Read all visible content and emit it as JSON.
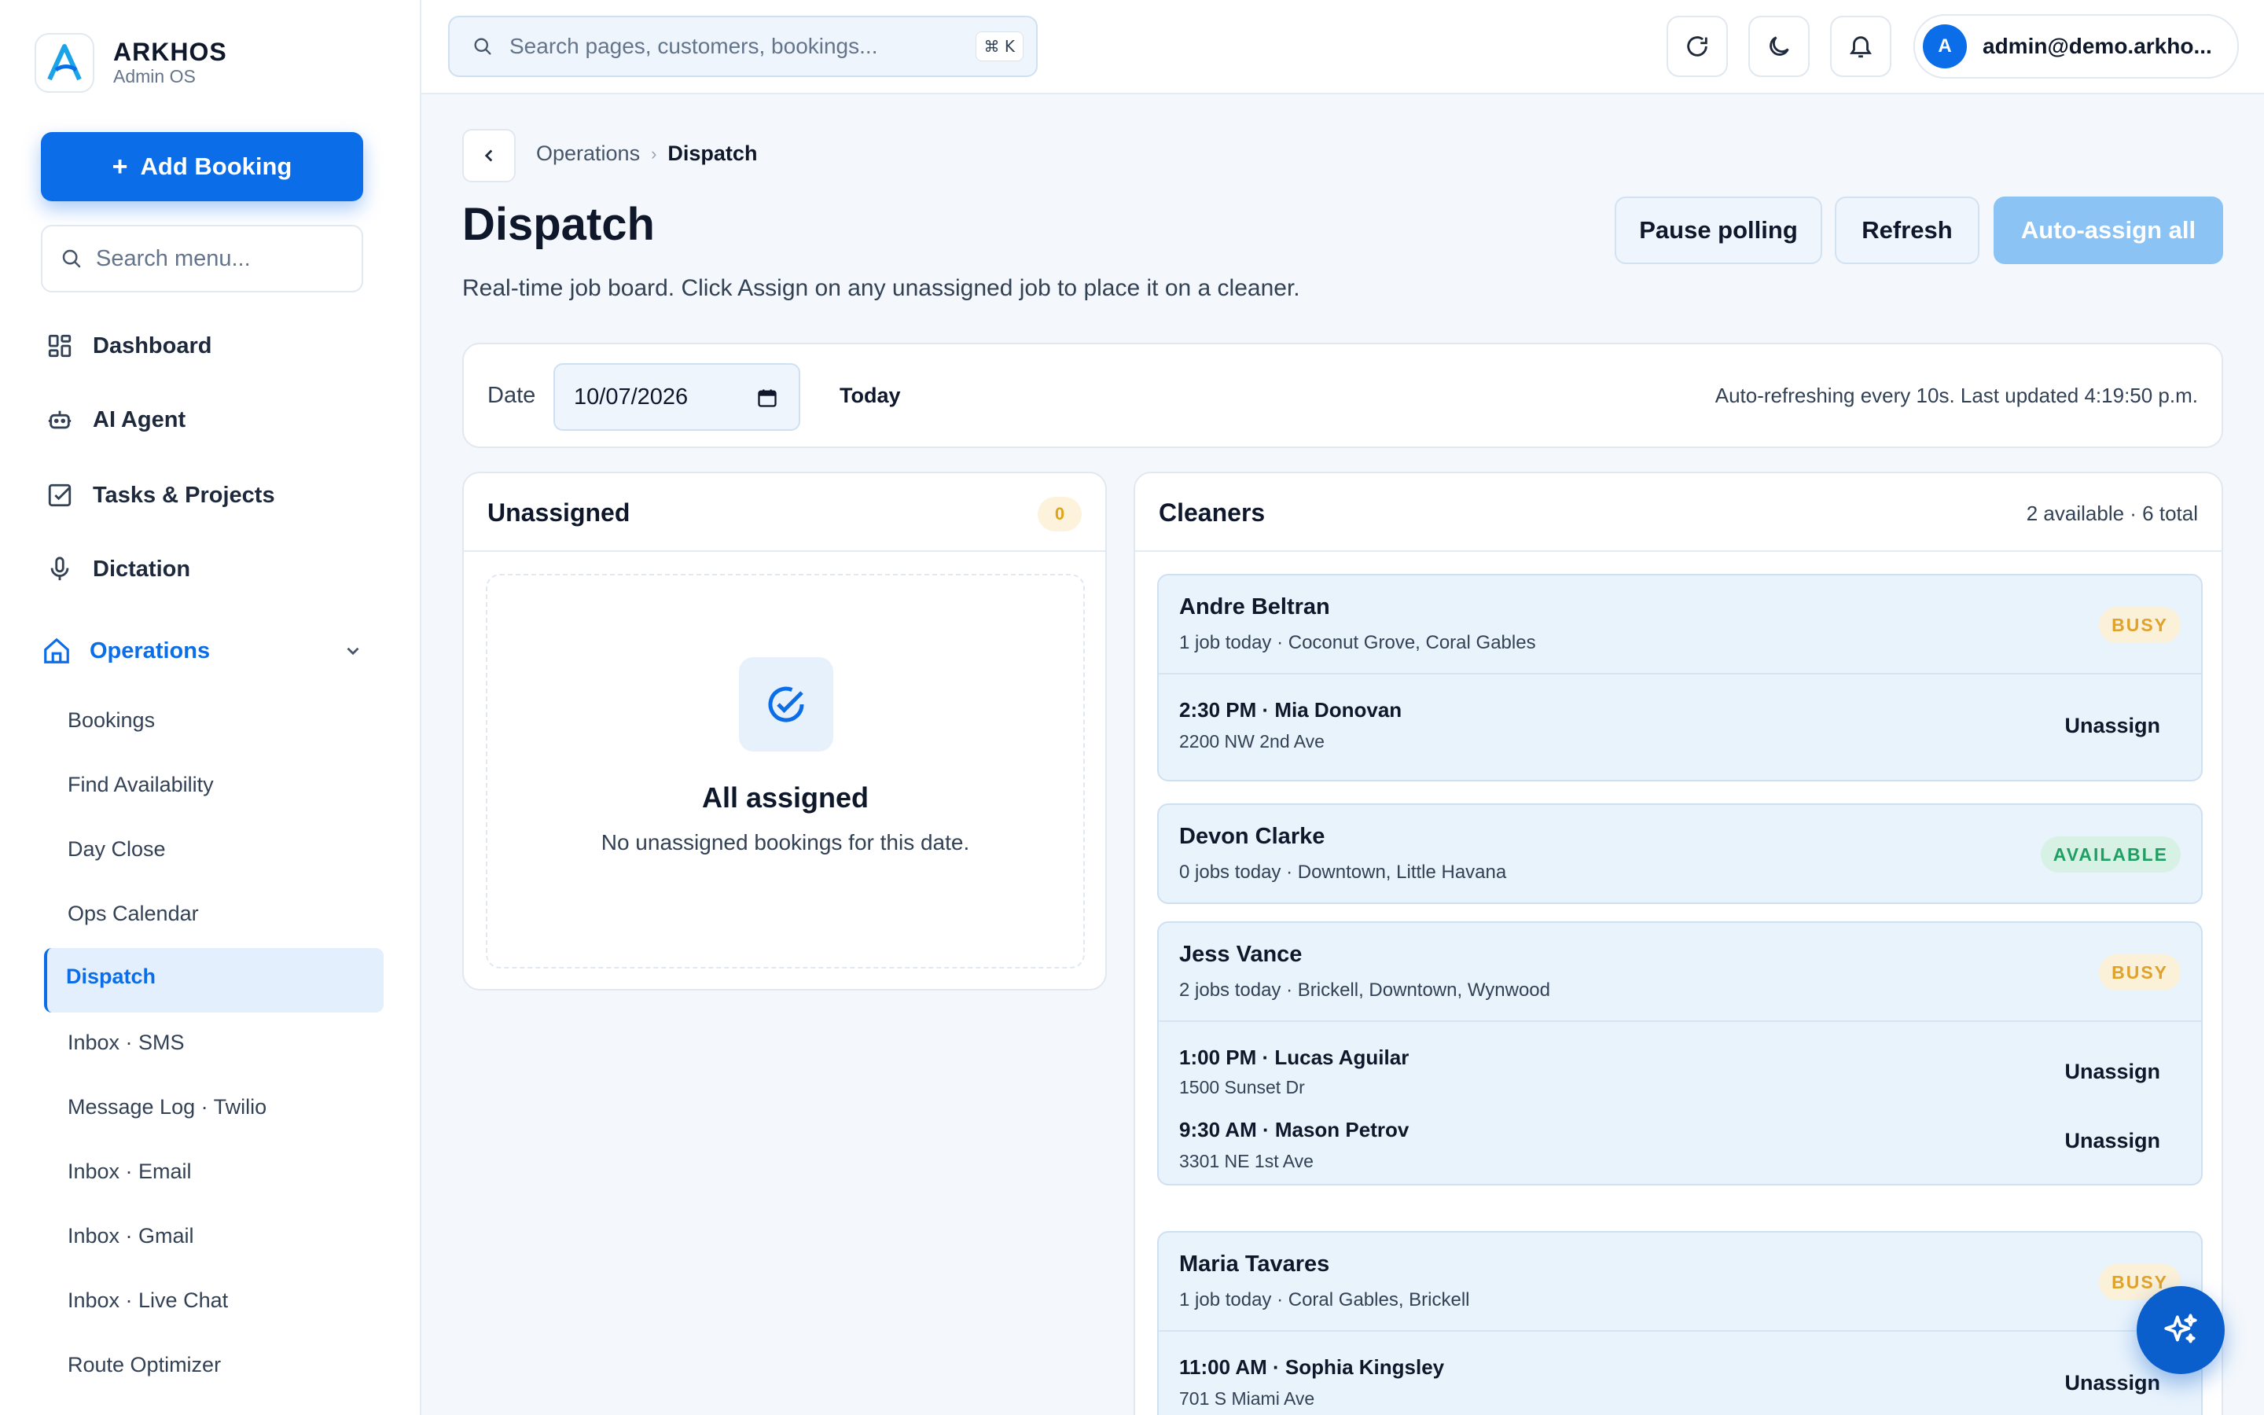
{
  "brand": {
    "name": "ARKHOS",
    "subtitle": "Admin OS"
  },
  "sidebar": {
    "add_booking": "Add Booking",
    "add_icon": "+",
    "search_placeholder": "Search menu...",
    "items": [
      {
        "label": "Dashboard",
        "icon": "grid-icon"
      },
      {
        "label": "AI Agent",
        "icon": "robot-icon"
      },
      {
        "label": "Tasks & Projects",
        "icon": "checkbox-icon"
      },
      {
        "label": "Dictation",
        "icon": "microphone-icon"
      },
      {
        "label": "Operations",
        "icon": "home-icon",
        "expanded": true
      }
    ],
    "sub_items": [
      "Bookings",
      "Find Availability",
      "Day Close",
      "Ops Calendar",
      "Dispatch",
      "Inbox · SMS",
      "Message Log · Twilio",
      "Inbox · Email",
      "Inbox · Gmail",
      "Inbox · Live Chat",
      "Route Optimizer"
    ],
    "active_sub": "Dispatch"
  },
  "topbar": {
    "search_placeholder": "Search pages, customers, bookings...",
    "shortcut": "⌘ K",
    "user_initial": "A",
    "user_email": "admin@demo.arkho..."
  },
  "page": {
    "breadcrumb": [
      "Operations",
      "Dispatch"
    ],
    "title": "Dispatch",
    "description": "Real-time job board. Click Assign on any unassigned job to place it on a cleaner.",
    "buttons": {
      "pause": "Pause polling",
      "refresh": "Refresh",
      "auto_assign": "Auto-assign all"
    }
  },
  "date_bar": {
    "label": "Date",
    "value": "10/07/2026",
    "today": "Today",
    "refresh_note": "Auto-refreshing every 10s. Last updated 4:19:50 p.m."
  },
  "unassigned": {
    "title": "Unassigned",
    "count": "0",
    "empty_title": "All assigned",
    "empty_sub": "No unassigned bookings for this date."
  },
  "cleaners": {
    "title": "Cleaners",
    "summary": "2 available · 6 total",
    "unassign_label": "Unassign",
    "list": [
      {
        "name": "Andre Beltran",
        "sub": "1 job today · Coconut Grove, Coral Gables",
        "status": "BUSY",
        "jobs": [
          {
            "title": "2:30 PM · Mia Donovan",
            "addr": "2200 NW 2nd Ave"
          }
        ]
      },
      {
        "name": "Devon Clarke",
        "sub": "0 jobs today · Downtown, Little Havana",
        "status": "AVAILABLE",
        "jobs": []
      },
      {
        "name": "Jess Vance",
        "sub": "2 jobs today · Brickell, Downtown, Wynwood",
        "status": "BUSY",
        "jobs": [
          {
            "title": "1:00 PM · Lucas Aguilar",
            "addr": "1500 Sunset Dr"
          },
          {
            "title": "9:30 AM · Mason Petrov",
            "addr": "3301 NE 1st Ave"
          }
        ]
      },
      {
        "name": "Maria Tavares",
        "sub": "1 job today · Coral Gables, Brickell",
        "status": "BUSY",
        "jobs": [
          {
            "title": "11:00 AM · Sophia Kingsley",
            "addr": "701 S Miami Ave"
          }
        ]
      }
    ]
  },
  "colors": {
    "accent": "#0b6ee8",
    "busy": "#dfa22a",
    "available": "#1f9f63"
  }
}
